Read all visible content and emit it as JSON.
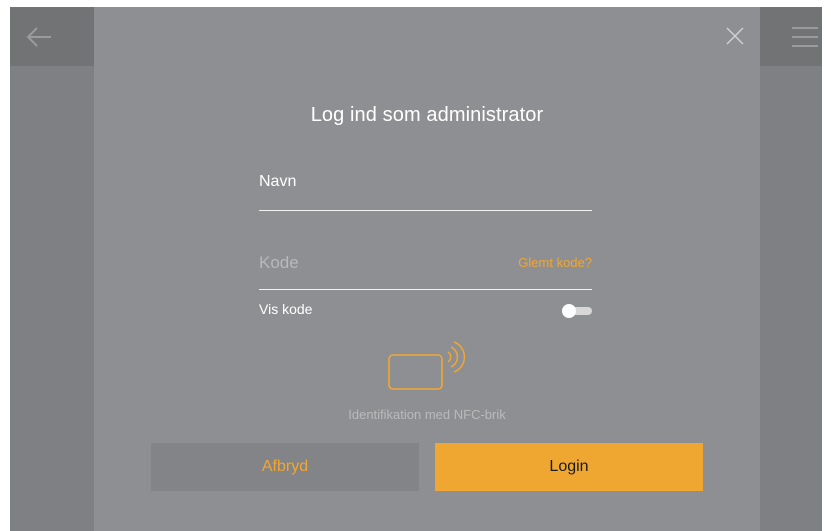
{
  "header": {
    "back_icon": "arrow-left-icon",
    "menu_icon": "hamburger-menu-icon"
  },
  "dialog": {
    "close_icon": "close-icon",
    "title": "Log ind som administrator",
    "name_field": {
      "value": "Navn"
    },
    "code_field": {
      "placeholder": "Kode",
      "forgot_link": "Glemt kode?"
    },
    "show_code": {
      "label": "Vis kode",
      "enabled": false
    },
    "nfc": {
      "icon": "nfc-card-icon",
      "label": "Identifikation med NFC-brik"
    },
    "buttons": {
      "cancel": "Afbryd",
      "login": "Login"
    }
  },
  "colors": {
    "accent": "#f0a732",
    "background": "#7f8083",
    "dialog": "#8e8f92"
  }
}
